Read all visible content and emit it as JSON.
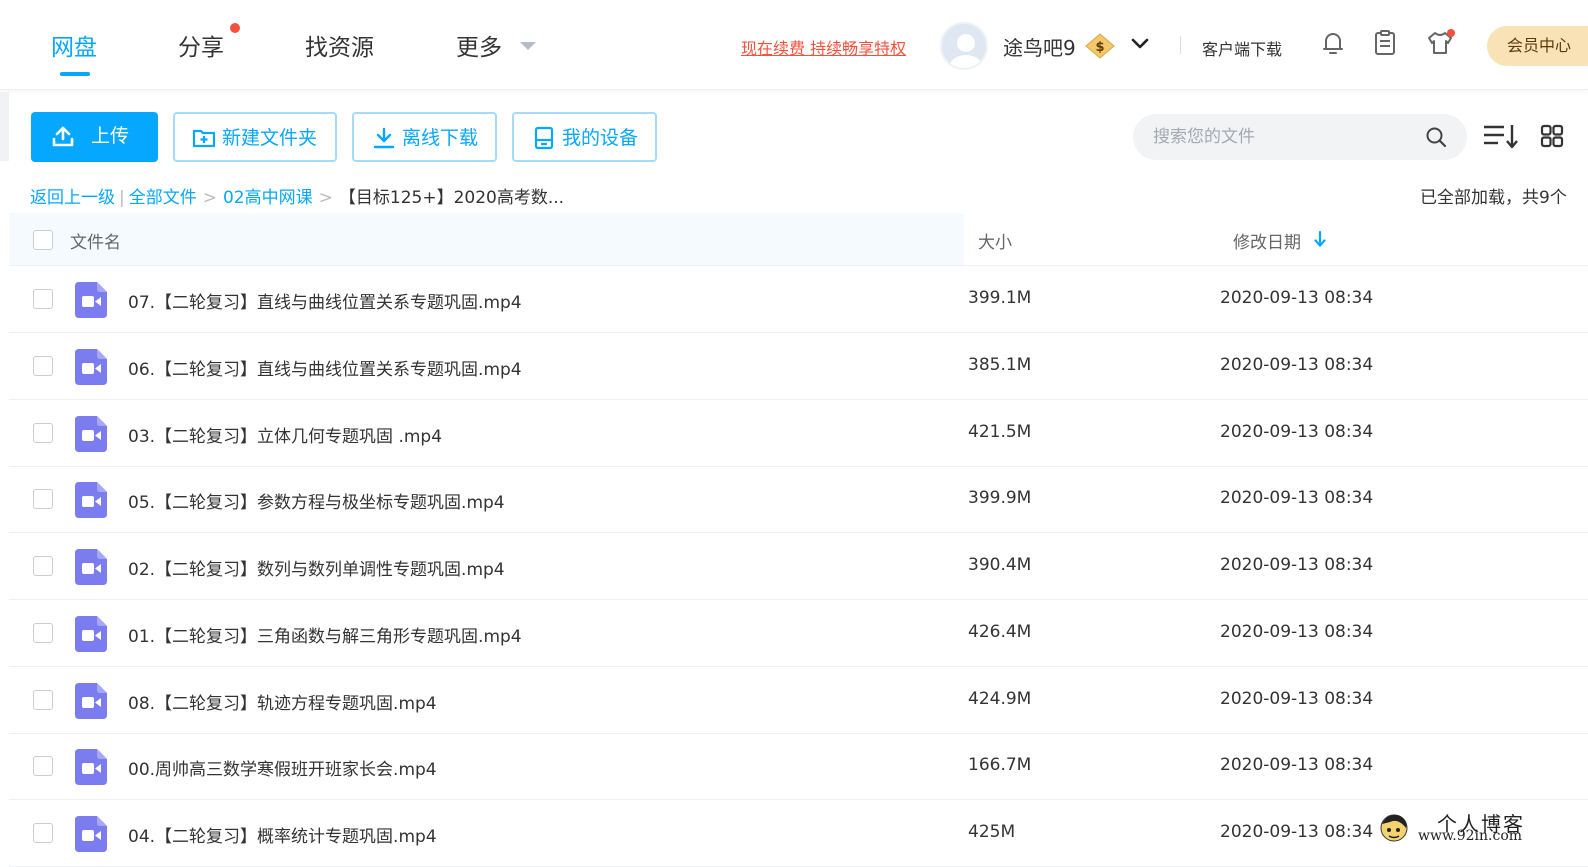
{
  "nav": {
    "tabs": [
      {
        "label": "网盘"
      },
      {
        "label": "分享"
      },
      {
        "label": "找资源"
      },
      {
        "label": "更多"
      }
    ],
    "promo": "现在续费 持续畅享特权",
    "username": "途鸟吧9",
    "vip_badge": "$",
    "client_download": "客户端下载",
    "member_center": "会员中心"
  },
  "toolbar": {
    "upload": "上传",
    "new_folder": "新建文件夹",
    "offline_download": "离线下载",
    "my_devices": "我的设备",
    "search_placeholder": "搜索您的文件"
  },
  "breadcrumb": {
    "back": "返回上一级",
    "all_files": "全部文件",
    "folder": "02高中网课",
    "current": "【目标125+】2020高考数...",
    "loaded_status": "已全部加载，共9个"
  },
  "table": {
    "col_name": "文件名",
    "col_size": "大小",
    "col_date": "修改日期",
    "rows": [
      {
        "name": "07.【二轮复习】直线与曲线位置关系专题巩固.mp4",
        "size": "399.1M",
        "date": "2020-09-13 08:34"
      },
      {
        "name": "06.【二轮复习】直线与曲线位置关系专题巩固.mp4",
        "size": "385.1M",
        "date": "2020-09-13 08:34"
      },
      {
        "name": "03.【二轮复习】立体几何专题巩固 .mp4",
        "size": "421.5M",
        "date": "2020-09-13 08:34"
      },
      {
        "name": "05.【二轮复习】参数方程与极坐标专题巩固.mp4",
        "size": "399.9M",
        "date": "2020-09-13 08:34"
      },
      {
        "name": "02.【二轮复习】数列与数列单调性专题巩固.mp4",
        "size": "390.4M",
        "date": "2020-09-13 08:34"
      },
      {
        "name": "01.【二轮复习】三角函数与解三角形专题巩固.mp4",
        "size": "426.4M",
        "date": "2020-09-13 08:34"
      },
      {
        "name": "08.【二轮复习】轨迹方程专题巩固.mp4",
        "size": "424.9M",
        "date": "2020-09-13 08:34"
      },
      {
        "name": "00.周帅高三数学寒假班开班家长会.mp4",
        "size": "166.7M",
        "date": "2020-09-13 08:34"
      },
      {
        "name": "04.【二轮复习】概率统计专题巩固.mp4",
        "size": "425M",
        "date": "2020-09-13 08:34"
      }
    ]
  },
  "watermark": {
    "line1": "个人博客",
    "line2": "www.92in.com"
  },
  "colors": {
    "accent": "#06a7ff",
    "promo_red": "#f5503c",
    "video_icon": "#7b7cf0",
    "member_gold": "#f8e2b6"
  },
  "icons": [
    "upload-icon",
    "new-folder-icon",
    "download-icon",
    "device-icon",
    "search-icon",
    "sort-icon",
    "grid-view-icon",
    "bell-icon",
    "clipboard-icon",
    "shirt-icon",
    "video-file-icon",
    "chevron-down-icon"
  ]
}
